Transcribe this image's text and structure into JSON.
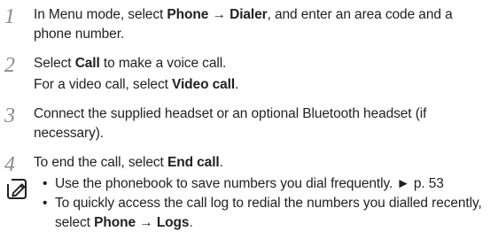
{
  "steps": [
    {
      "number": "1",
      "intro": "In Menu mode, select ",
      "menu_a": "Phone",
      "arrow": " → ",
      "menu_b": "Dialer",
      "rest": ", and enter an area code and a phone number."
    },
    {
      "number": "2",
      "pre": "Select ",
      "bold": "Call",
      "post": " to make a voice call.",
      "line2_pre": "For a video call, select ",
      "line2_bold": "Video call",
      "line2_post": "."
    },
    {
      "number": "3",
      "text": "Connect the supplied headset or an optional Bluetooth headset (if necessary)."
    },
    {
      "number": "4",
      "pre": "To end the call, select ",
      "bold": "End call",
      "post": "."
    }
  ],
  "note": {
    "icon": "note-pencil-icon",
    "bullet_symbol": "•",
    "tip1_text": "Use the phonebook to save numbers you dial frequently. ",
    "tip1_ref": "► p. 53",
    "tip2_pre": "To quickly access the call log to redial the numbers you dialled recently, select ",
    "tip2_bold_a": "Phone",
    "tip2_arrow": " → ",
    "tip2_bold_b": "Logs",
    "tip2_post": "."
  }
}
